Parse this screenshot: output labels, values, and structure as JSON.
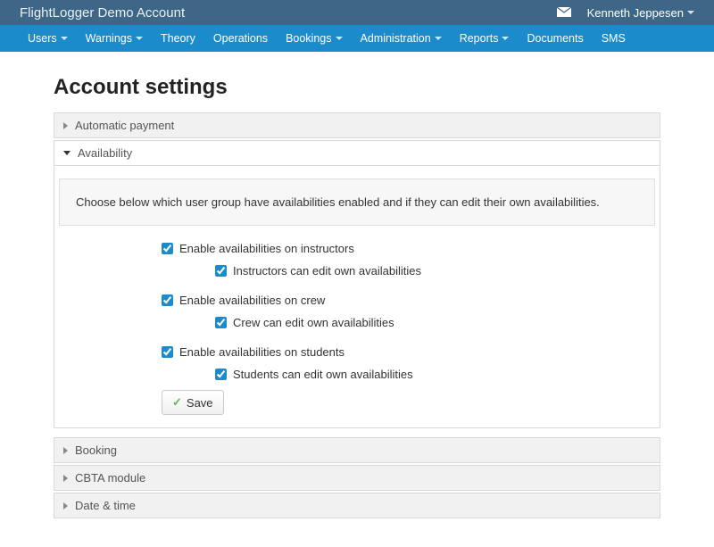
{
  "topbar": {
    "brand": "FlightLogger Demo Account",
    "user_name": "Kenneth Jeppesen"
  },
  "nav": {
    "items": [
      {
        "label": "Users",
        "dropdown": true
      },
      {
        "label": "Warnings",
        "dropdown": true
      },
      {
        "label": "Theory",
        "dropdown": false
      },
      {
        "label": "Operations",
        "dropdown": false
      },
      {
        "label": "Bookings",
        "dropdown": true
      },
      {
        "label": "Administration",
        "dropdown": true
      },
      {
        "label": "Reports",
        "dropdown": true
      },
      {
        "label": "Documents",
        "dropdown": false
      },
      {
        "label": "SMS",
        "dropdown": false
      }
    ]
  },
  "page": {
    "title": "Account settings"
  },
  "accordion": {
    "automatic_payment": "Automatic payment",
    "availability": "Availability",
    "booking": "Booking",
    "cbta": "CBTA module",
    "date_time": "Date & time"
  },
  "availability_panel": {
    "help": "Choose below which user group have availabilities enabled and if they can edit their own availabilities.",
    "instructors_enable": "Enable availabilities on instructors",
    "instructors_edit": "Instructors can edit own availabilities",
    "crew_enable": "Enable availabilities on crew",
    "crew_edit": "Crew can edit own availabilities",
    "students_enable": "Enable availabilities on students",
    "students_edit": "Students can edit own availabilities",
    "save_label": "Save"
  }
}
